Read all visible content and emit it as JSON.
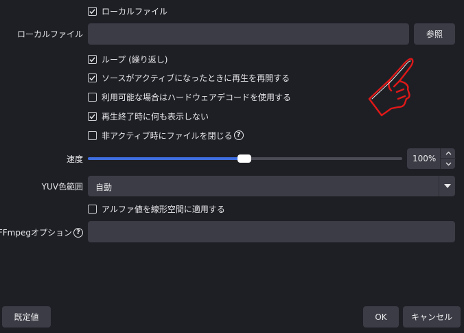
{
  "local_file_checkbox": {
    "label": "ローカルファイル",
    "checked": true
  },
  "local_file_field": {
    "label": "ローカルファイル",
    "value": "",
    "browse_label": "参照"
  },
  "options": [
    {
      "label": "ループ (繰り返し)",
      "checked": true
    },
    {
      "label": "ソースがアクティブになったときに再生を再開する",
      "checked": true
    },
    {
      "label": "利用可能な場合はハードウェアデコードを使用する",
      "checked": false
    },
    {
      "label": "再生終了時に何も表示しない",
      "checked": true
    },
    {
      "label": "非アクティブ時にファイルを閉じる",
      "checked": false
    }
  ],
  "speed": {
    "label": "速度",
    "value": "100%",
    "slider_fraction": 0.5
  },
  "yuv_range": {
    "label": "YUV色範囲",
    "selected": "自動"
  },
  "alpha_linear": {
    "label": "アルファ値を線形空間に適用する",
    "checked": false
  },
  "ffmpeg_options": {
    "label": "FFmpegオプション",
    "value": ""
  },
  "footer": {
    "defaults_label": "既定値",
    "ok_label": "OK",
    "cancel_label": "キャンセル"
  },
  "colors": {
    "background": "#1e1f25",
    "field": "#3b3c45",
    "accent": "#3f6ee0",
    "pointer_hand": "#e01818"
  },
  "icons": {
    "check": "check-icon",
    "help": "help-circle-icon",
    "dropdown": "chevron-down-icon",
    "pointer": "pointing-hand-icon"
  }
}
